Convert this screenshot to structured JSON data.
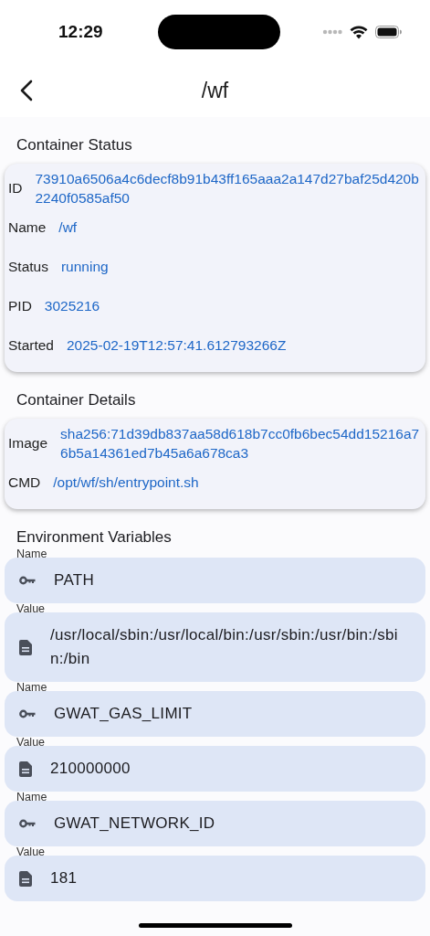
{
  "status_bar": {
    "time": "12:29"
  },
  "app_bar": {
    "title": "/wf"
  },
  "sections": [
    {
      "title": "Container Status",
      "rows": [
        {
          "label": "ID",
          "value": "73910a6506a4c6decf8b91b43ff165aaa2a147d27baf25d420b2240f0585af50"
        },
        {
          "label": "Name",
          "value": "/wf"
        },
        {
          "label": "Status",
          "value": "running"
        },
        {
          "label": "PID",
          "value": "3025216"
        },
        {
          "label": "Started",
          "value": "2025-02-19T12:57:41.612793266Z"
        }
      ]
    },
    {
      "title": "Container Details",
      "rows": [
        {
          "label": "Image",
          "value": "sha256:71d39db837aa58d618b7cc0fb6bec54dd15216a76b5a14361ed7b45a6a678ca3"
        },
        {
          "label": "CMD",
          "value": "/opt/wf/sh/entrypoint.sh"
        }
      ]
    }
  ],
  "environment": {
    "title": "Environment Variables",
    "fields": [
      {
        "kind": "name",
        "label": "Name",
        "value": "PATH"
      },
      {
        "kind": "value",
        "label": "Value",
        "value": "/usr/local/sbin:/usr/local/bin:/usr/sbin:/usr/bin:/sbin:/bin"
      },
      {
        "kind": "name",
        "label": "Name",
        "value": "GWAT_GAS_LIMIT"
      },
      {
        "kind": "value",
        "label": "Value",
        "value": "210000000"
      },
      {
        "kind": "name",
        "label": "Name",
        "value": "GWAT_NETWORK_ID"
      },
      {
        "kind": "value",
        "label": "Value",
        "value": "181"
      }
    ]
  }
}
